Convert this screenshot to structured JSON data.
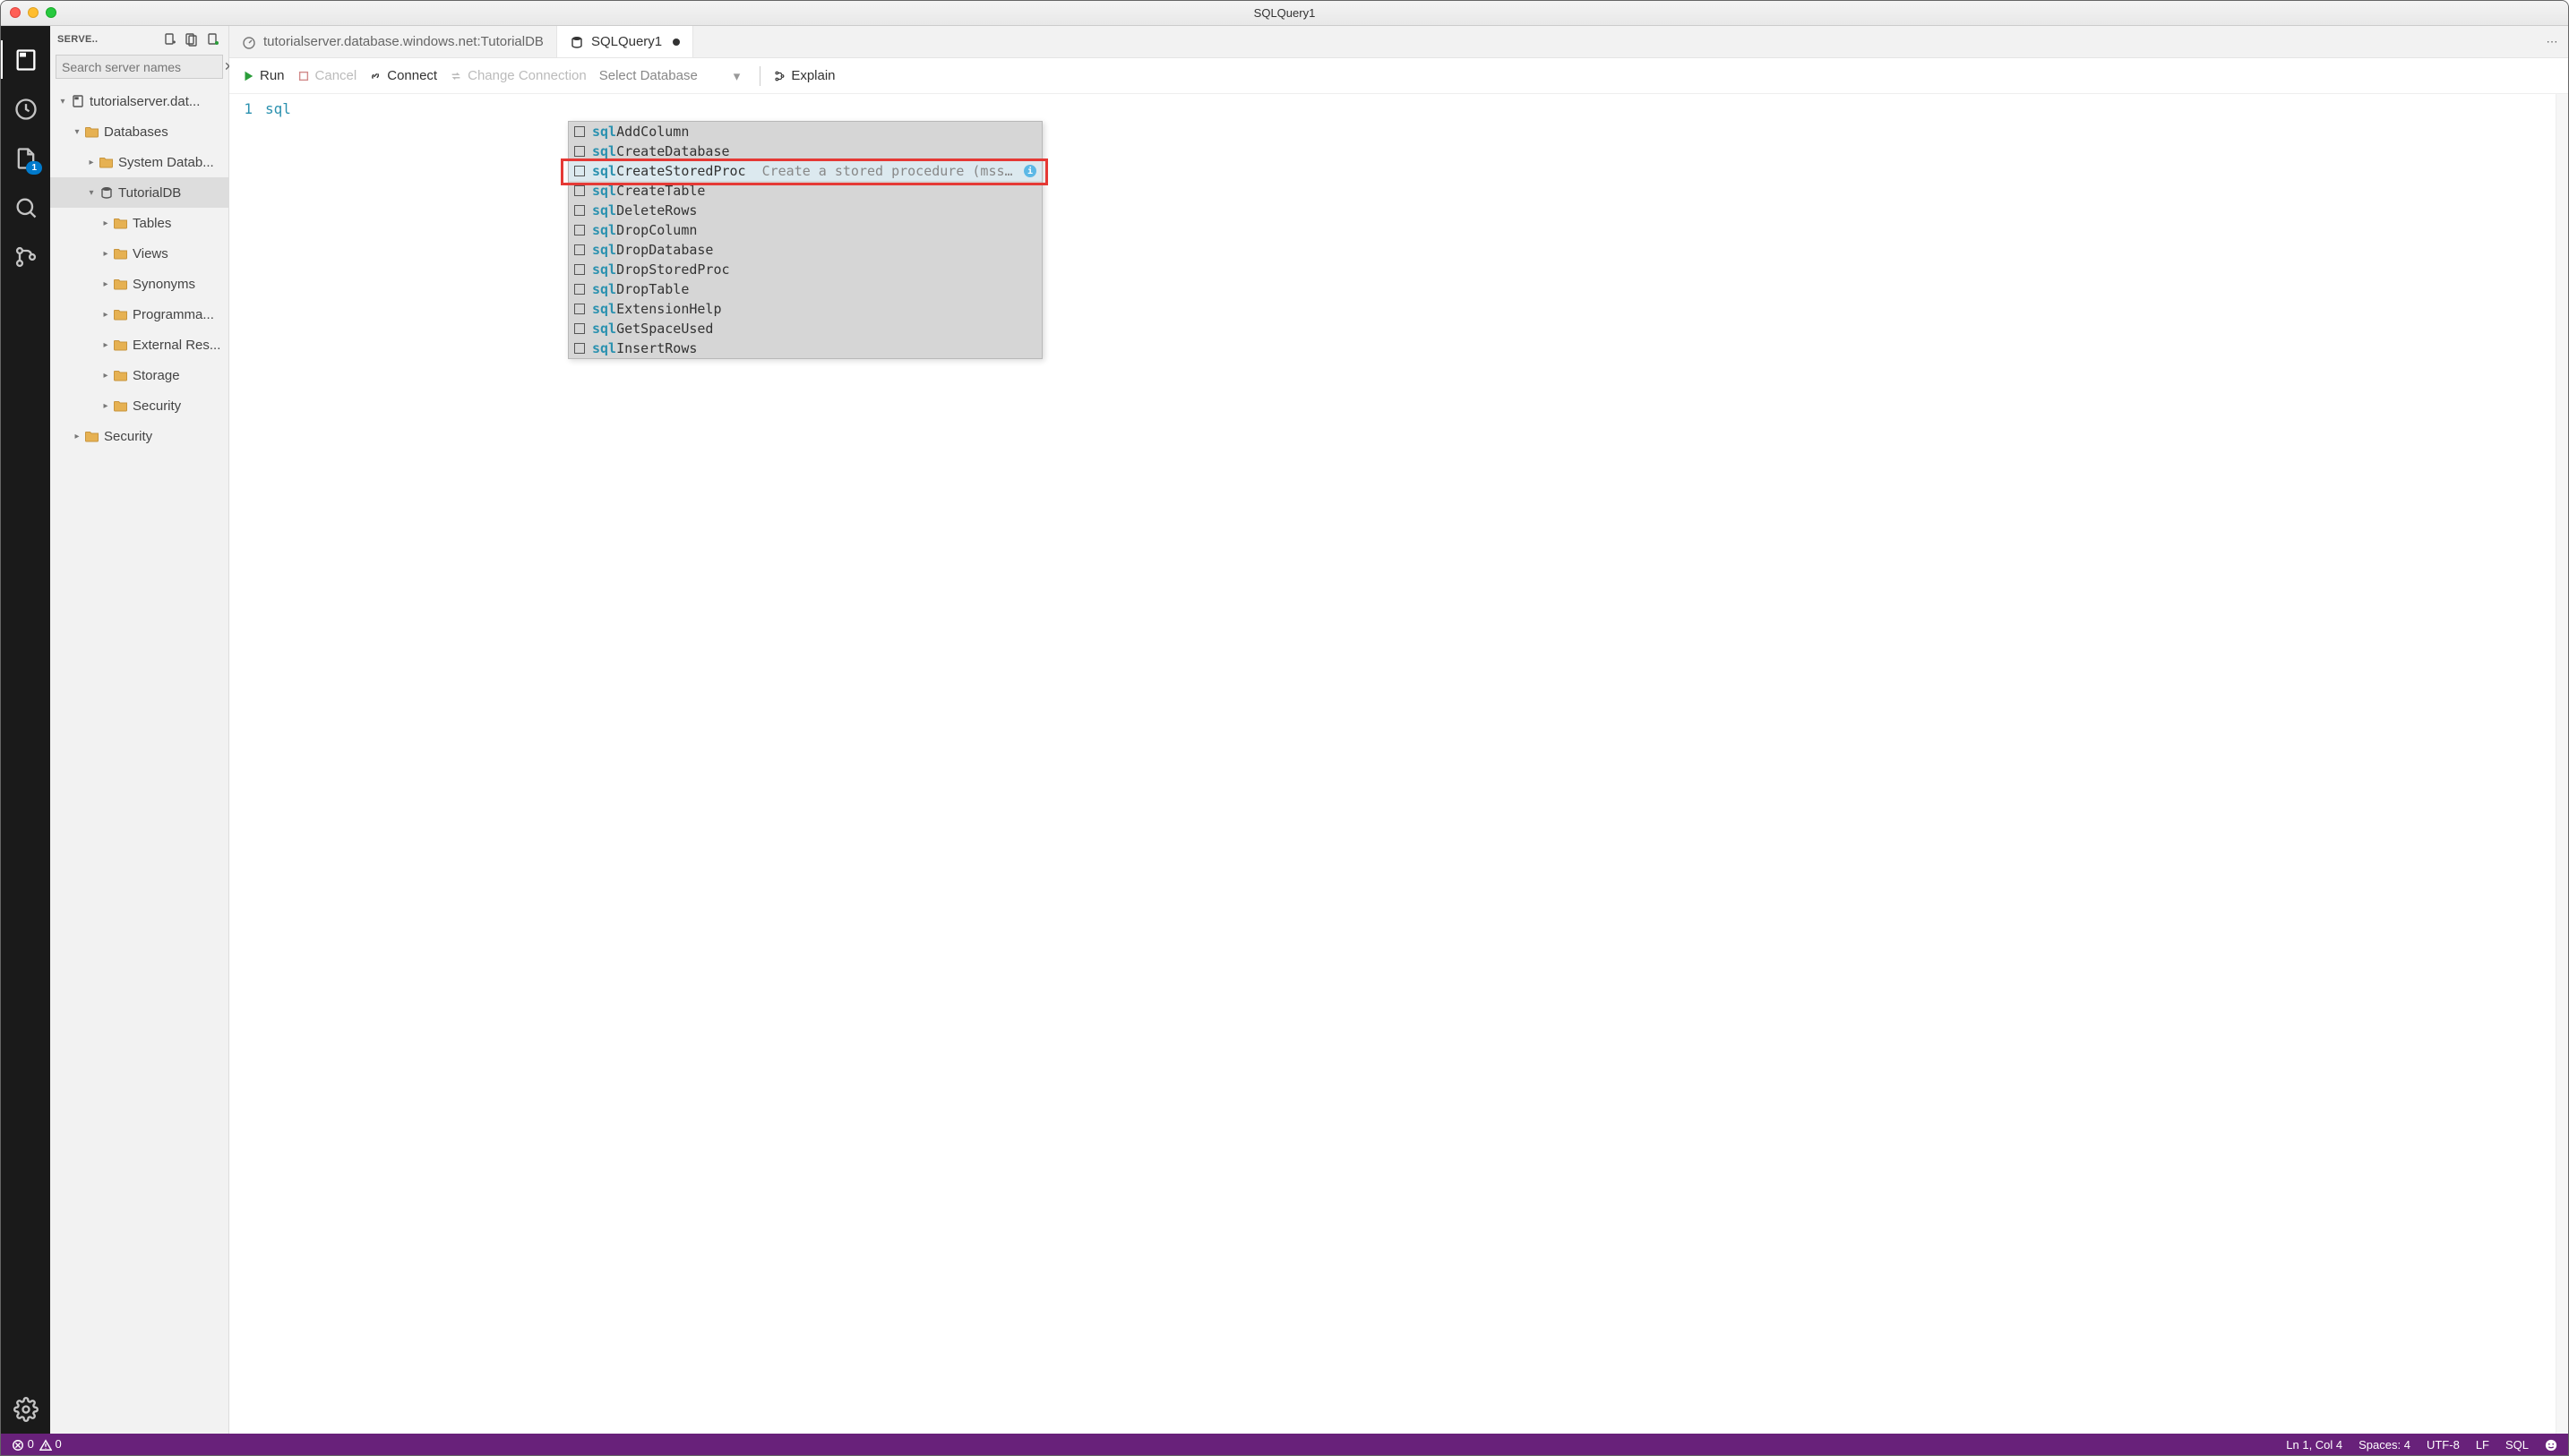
{
  "window": {
    "title": "SQLQuery1"
  },
  "activitybar": {
    "items": [
      {
        "name": "servers-icon"
      },
      {
        "name": "history-icon"
      },
      {
        "name": "file-icon",
        "badge": "1"
      },
      {
        "name": "search-icon"
      },
      {
        "name": "source-control-icon"
      }
    ],
    "bottom": {
      "name": "settings-icon"
    }
  },
  "panel": {
    "header": "SERVE..",
    "search_placeholder": "Search server names"
  },
  "tree": [
    {
      "depth": 0,
      "twist": "expanded",
      "icon": "server",
      "label": "tutorialserver.dat..."
    },
    {
      "depth": 1,
      "twist": "expanded",
      "icon": "folder",
      "label": "Databases"
    },
    {
      "depth": 2,
      "twist": "collapsed",
      "icon": "folder",
      "label": "System Datab..."
    },
    {
      "depth": 2,
      "twist": "expanded",
      "icon": "database",
      "label": "TutorialDB",
      "selected": true
    },
    {
      "depth": 3,
      "twist": "collapsed",
      "icon": "folder",
      "label": "Tables"
    },
    {
      "depth": 3,
      "twist": "collapsed",
      "icon": "folder",
      "label": "Views"
    },
    {
      "depth": 3,
      "twist": "collapsed",
      "icon": "folder",
      "label": "Synonyms"
    },
    {
      "depth": 3,
      "twist": "collapsed",
      "icon": "folder",
      "label": "Programma..."
    },
    {
      "depth": 3,
      "twist": "collapsed",
      "icon": "folder",
      "label": "External Res..."
    },
    {
      "depth": 3,
      "twist": "collapsed",
      "icon": "folder",
      "label": "Storage"
    },
    {
      "depth": 3,
      "twist": "collapsed",
      "icon": "folder",
      "label": "Security"
    },
    {
      "depth": 1,
      "twist": "collapsed",
      "icon": "folder",
      "label": "Security"
    }
  ],
  "tabs": [
    {
      "icon": "dashboard",
      "label": "tutorialserver.database.windows.net:TutorialDB",
      "active": false
    },
    {
      "icon": "db",
      "label": "SQLQuery1",
      "active": true,
      "dirty": true
    }
  ],
  "toolbar": {
    "run": "Run",
    "cancel": "Cancel",
    "connect": "Connect",
    "change": "Change Connection",
    "dbselect": "Select Database",
    "explain": "Explain"
  },
  "editor": {
    "line_number": "1",
    "text": "sql"
  },
  "completions": {
    "match_prefix": "sql",
    "items": [
      {
        "suffix": "AddColumn"
      },
      {
        "suffix": "CreateDatabase"
      },
      {
        "suffix": "CreateStoredProc",
        "desc": "Create a stored procedure (mssq…",
        "selected": true
      },
      {
        "suffix": "CreateTable"
      },
      {
        "suffix": "DeleteRows"
      },
      {
        "suffix": "DropColumn"
      },
      {
        "suffix": "DropDatabase"
      },
      {
        "suffix": "DropStoredProc"
      },
      {
        "suffix": "DropTable"
      },
      {
        "suffix": "ExtensionHelp"
      },
      {
        "suffix": "GetSpaceUsed"
      },
      {
        "suffix": "InsertRows"
      }
    ]
  },
  "status": {
    "errors": "0",
    "warnings": "0",
    "lncol": "Ln 1, Col 4",
    "spaces": "Spaces: 4",
    "encoding": "UTF-8",
    "eol": "LF",
    "lang": "SQL"
  }
}
